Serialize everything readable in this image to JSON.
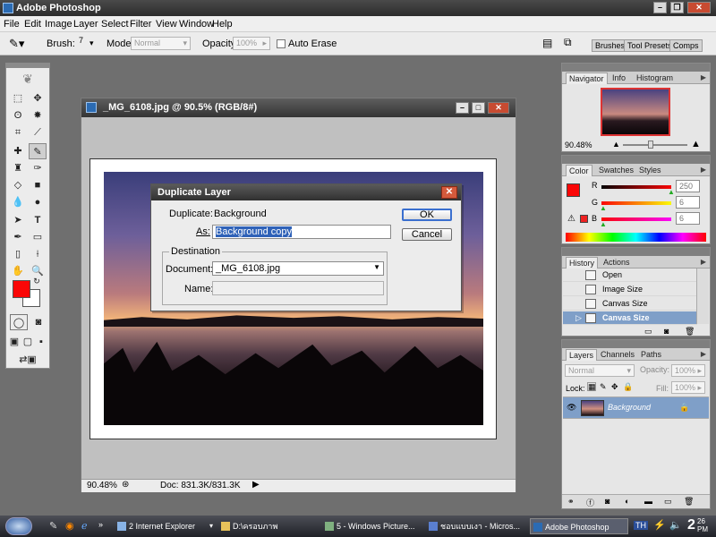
{
  "app": {
    "title": "Adobe Photoshop"
  },
  "menus": [
    "File",
    "Edit",
    "Image",
    "Layer",
    "Select",
    "Filter",
    "View",
    "Window",
    "Help"
  ],
  "options": {
    "brush_label": "Brush:",
    "brush_size": "7",
    "mode_label": "Mode:",
    "mode_value": "Normal",
    "opacity_label": "Opacity:",
    "opacity_value": "100%",
    "auto_erase_label": "Auto Erase",
    "well_tabs": [
      "Brushes",
      "Tool Presets",
      "Comps"
    ]
  },
  "document": {
    "title": "_MG_6108.jpg @ 90.5% (RGB/8#)",
    "zoom": "90.48%",
    "doc_info": "Doc: 831.3K/831.3K"
  },
  "dialog": {
    "title": "Duplicate Layer",
    "duplicate_label": "Duplicate:",
    "duplicate_value": "Background",
    "as_label": "As:",
    "as_value": "Background copy",
    "destination_label": "Destination",
    "document_label": "Document:",
    "document_value": "_MG_6108.jpg",
    "name_label": "Name:",
    "name_value": "",
    "ok_label": "OK",
    "cancel_label": "Cancel"
  },
  "navigator": {
    "tabs": [
      "Navigator",
      "Info",
      "Histogram"
    ],
    "zoom": "90.48%"
  },
  "color_panel": {
    "tabs": [
      "Color",
      "Swatches",
      "Styles"
    ],
    "r_label": "R",
    "g_label": "G",
    "b_label": "B",
    "r": "250",
    "g": "6",
    "b": "6",
    "foreground": "#fa0606"
  },
  "history": {
    "tabs": [
      "History",
      "Actions"
    ],
    "items": [
      "Open",
      "Image Size",
      "Canvas Size",
      "Canvas Size"
    ]
  },
  "layers": {
    "tabs": [
      "Layers",
      "Channels",
      "Paths"
    ],
    "blend_mode": "Normal",
    "opacity_label": "Opacity:",
    "opacity_value": "100%",
    "lock_label": "Lock:",
    "fill_label": "Fill:",
    "fill_value": "100%",
    "layer_name": "Background"
  },
  "taskbar": {
    "items": [
      "2 Internet Explorer",
      "D:\\ครอบภาพ",
      "5 - Windows Picture...",
      "ชอบแบบเงา - Micros...",
      "Adobe Photoshop"
    ],
    "lang": "TH",
    "clock_hour": "2",
    "clock_min": "26",
    "clock_ampm": "PM"
  }
}
